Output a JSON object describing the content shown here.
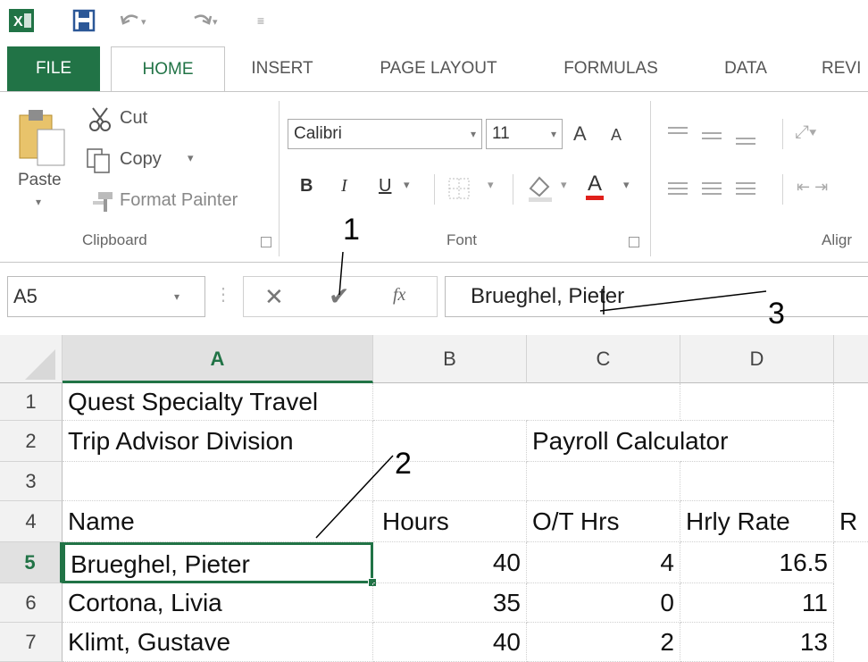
{
  "qat": {
    "icons": [
      "excel-logo-icon",
      "save-icon",
      "undo-icon",
      "redo-icon",
      "customize-icon"
    ]
  },
  "tabs": [
    "FILE",
    "HOME",
    "INSERT",
    "PAGE LAYOUT",
    "FORMULAS",
    "DATA",
    "REVI"
  ],
  "ribbon": {
    "clipboard": {
      "paste": "Paste",
      "cut": "Cut",
      "copy": "Copy",
      "format_painter": "Format Painter",
      "label": "Clipboard"
    },
    "font": {
      "font_name": "Calibri",
      "font_size": "11",
      "bold": "B",
      "italic": "I",
      "underline": "U",
      "grow": "A",
      "shrink": "A",
      "font_color": "A",
      "label": "Font"
    },
    "alignment": {
      "label": "Aligr"
    }
  },
  "formula_bar": {
    "name_box": "A5",
    "cancel": "✕",
    "enter": "✔",
    "fx": "fx",
    "value": "Brueghel, Pieter"
  },
  "columns": [
    "A",
    "B",
    "C",
    "D"
  ],
  "rows": [
    {
      "num": "1",
      "cells": [
        "Quest Specialty Travel",
        "",
        "",
        "",
        ""
      ]
    },
    {
      "num": "2",
      "cells": [
        "Trip Advisor Division",
        "",
        "Payroll Calculator",
        "",
        ""
      ]
    },
    {
      "num": "3",
      "cells": [
        "",
        "",
        "",
        "",
        ""
      ]
    },
    {
      "num": "4",
      "cells": [
        "Name",
        "Hours",
        "O/T Hrs",
        "Hrly Rate",
        "R"
      ]
    },
    {
      "num": "5",
      "cells": [
        "Brueghel, Pieter",
        "40",
        "4",
        "16.5",
        ""
      ]
    },
    {
      "num": "6",
      "cells": [
        "Cortona, Livia",
        "35",
        "0",
        "11",
        ""
      ]
    },
    {
      "num": "7",
      "cells": [
        "Klimt, Gustave",
        "40",
        "2",
        "13",
        ""
      ]
    }
  ],
  "callouts": [
    "1",
    "2",
    "3"
  ],
  "colors": {
    "excel_green": "#217346",
    "file_tab": "#217346"
  }
}
